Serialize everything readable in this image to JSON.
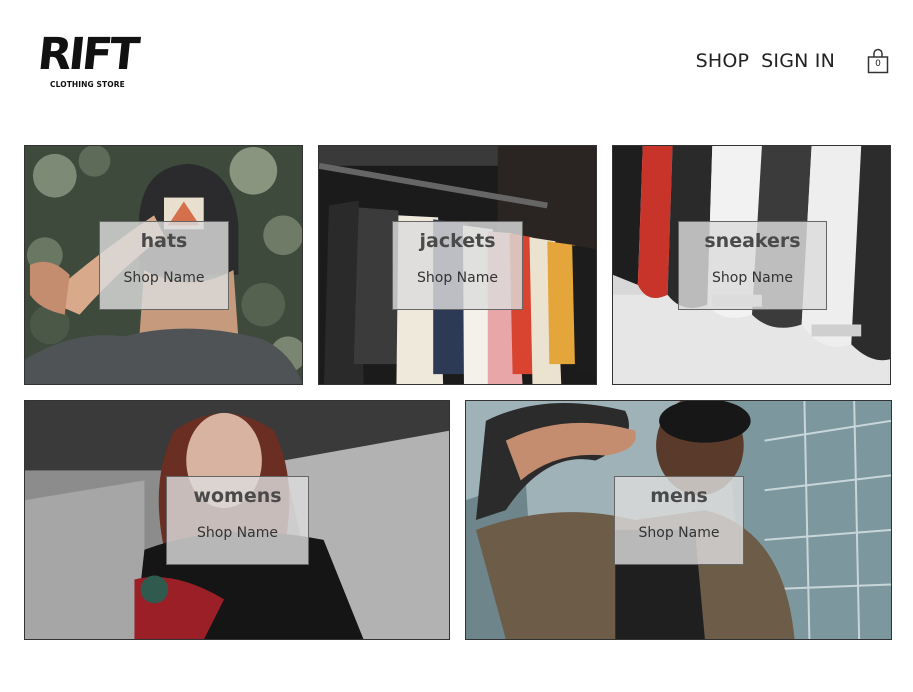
{
  "header": {
    "logo_text": "RIFT",
    "logo_subtitle": "CLOTHING STORE",
    "nav": {
      "shop": "SHOP",
      "sign_in": "SIGN IN"
    },
    "cart_count": "0"
  },
  "categories": [
    {
      "title": "hats",
      "subtitle": "Shop Name"
    },
    {
      "title": "jackets",
      "subtitle": "Shop Name"
    },
    {
      "title": "sneakers",
      "subtitle": "Shop Name"
    },
    {
      "title": "womens",
      "subtitle": "Shop Name"
    },
    {
      "title": "mens",
      "subtitle": "Shop Name"
    }
  ]
}
